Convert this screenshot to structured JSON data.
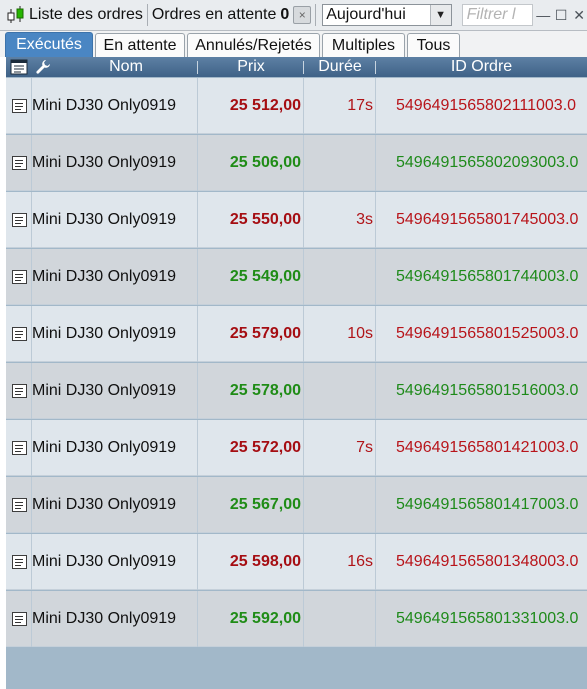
{
  "toolbar": {
    "title": "Liste des ordres",
    "pending_label": "Ordres en attente",
    "pending_count": "0",
    "close_glyph": "×",
    "period_value": "Aujourd'hui",
    "filter_placeholder": "Filtrer l",
    "window_minimize": "—",
    "window_maximize": "☐",
    "window_close": "✕"
  },
  "tabs": [
    {
      "label": "Exécutés",
      "active": true
    },
    {
      "label": "En attente",
      "active": false
    },
    {
      "label": "Annulés/Rejetés",
      "active": false
    },
    {
      "label": "Multiples",
      "active": false
    },
    {
      "label": "Tous",
      "active": false
    }
  ],
  "table": {
    "headers": {
      "name": "Nom",
      "price": "Prix",
      "duration": "Durée",
      "order_id": "ID Ordre"
    },
    "rows": [
      {
        "name": "Mini DJ30 Only0919",
        "price": "25 512,00",
        "duration": "17s",
        "order_id": "5496491565802111003.0",
        "side": "sell"
      },
      {
        "name": "Mini DJ30 Only0919",
        "price": "25 506,00",
        "duration": "",
        "order_id": "5496491565802093003.0",
        "side": "buy"
      },
      {
        "name": "Mini DJ30 Only0919",
        "price": "25 550,00",
        "duration": "3s",
        "order_id": "5496491565801745003.0",
        "side": "sell"
      },
      {
        "name": "Mini DJ30 Only0919",
        "price": "25 549,00",
        "duration": "",
        "order_id": "5496491565801744003.0",
        "side": "buy"
      },
      {
        "name": "Mini DJ30 Only0919",
        "price": "25 579,00",
        "duration": "10s",
        "order_id": "5496491565801525003.0",
        "side": "sell"
      },
      {
        "name": "Mini DJ30 Only0919",
        "price": "25 578,00",
        "duration": "",
        "order_id": "5496491565801516003.0",
        "side": "buy"
      },
      {
        "name": "Mini DJ30 Only0919",
        "price": "25 572,00",
        "duration": "7s",
        "order_id": "5496491565801421003.0",
        "side": "sell"
      },
      {
        "name": "Mini DJ30 Only0919",
        "price": "25 567,00",
        "duration": "",
        "order_id": "5496491565801417003.0",
        "side": "buy"
      },
      {
        "name": "Mini DJ30 Only0919",
        "price": "25 598,00",
        "duration": "16s",
        "order_id": "5496491565801348003.0",
        "side": "sell"
      },
      {
        "name": "Mini DJ30 Only0919",
        "price": "25 592,00",
        "duration": "",
        "order_id": "5496491565801331003.0",
        "side": "buy"
      }
    ]
  },
  "colors": {
    "accent": "#4a86c3",
    "header_bg": "#3f6287",
    "sell_red": "#a50d12",
    "buy_green": "#1f8c16"
  }
}
